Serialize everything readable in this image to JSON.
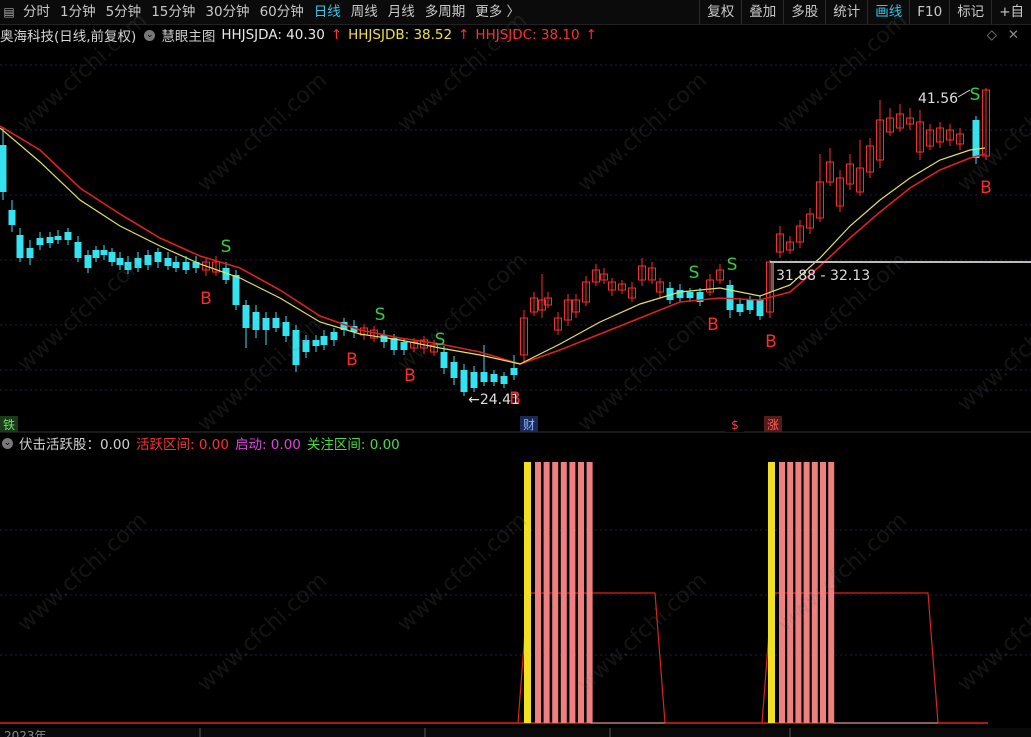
{
  "toolbar": {
    "periods": [
      "分时",
      "1分钟",
      "5分钟",
      "15分钟",
      "30分钟",
      "60分钟",
      "日线",
      "周线",
      "月线",
      "多周期",
      "更多 〉"
    ],
    "active_period": "日线",
    "right_buttons": [
      "复权",
      "叠加",
      "多股",
      "统计",
      "画线",
      "F10",
      "标记",
      "+自"
    ],
    "active_right": "画线"
  },
  "main_legend": {
    "stock": "奥海科技(日线,前复权)",
    "indicator": "慧眼主图",
    "a_label": "HHJSJDA: 40.30",
    "b_label": "HHJSJDB: 38.52",
    "c_label": "HHJSJDC: 38.10",
    "arrow": "↑",
    "colors": {
      "a": "#e8e8e8",
      "b": "#f0e040",
      "c": "#ff3030"
    }
  },
  "annotations": {
    "high": "41.56",
    "low": "←24.41",
    "range": "31.88 - 32.13",
    "event_tags": [
      "铁",
      "财",
      "$",
      "涨"
    ]
  },
  "signals": {
    "buy": "B",
    "sell": "S"
  },
  "indicator_legend": {
    "name": "伏击活跃股：0.00",
    "active_zone": "活跃区间: 0.00",
    "start": "启动: 0.00",
    "watch_zone": "关注区间: 0.00",
    "colors": {
      "name": "#d0d0d0",
      "active_zone": "#ff3030",
      "start": "#e040e0",
      "watch_zone": "#40e040"
    }
  },
  "date_axis": {
    "year_label": "2023年"
  },
  "watermark": "www.cfchi.com",
  "colors": {
    "up": "#ff2a2a",
    "down": "#35e3f0",
    "background": "#000000"
  }
}
